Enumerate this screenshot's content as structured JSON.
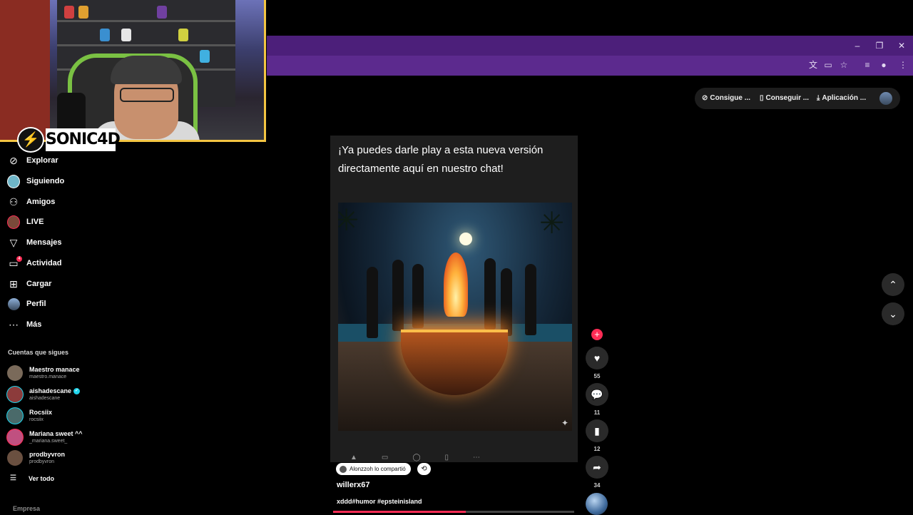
{
  "browser": {
    "window_controls": {
      "minimize": "–",
      "restore": "❐",
      "close": "✕"
    },
    "toolbar_icons": [
      "translate-icon",
      "cast-icon",
      "star-icon",
      "media-icon",
      "extension-icon",
      "menu-icon"
    ]
  },
  "overlay": {
    "brand_name": "SONIC4D",
    "brand_logo_glyph": "⚡"
  },
  "topbar": {
    "item1": "Consigue ...",
    "item2": "Conseguir ...",
    "item3": "Aplicación ..."
  },
  "sidebar": {
    "nav": [
      {
        "label": "Explorar",
        "icon": "compass-icon"
      },
      {
        "label": "Siguiendo",
        "icon": "following-avatar-icon"
      },
      {
        "label": "Amigos",
        "icon": "people-icon"
      },
      {
        "label": "LIVE",
        "icon": "live-avatar-icon"
      },
      {
        "label": "Mensajes",
        "icon": "send-icon"
      },
      {
        "label": "Actividad",
        "icon": "activity-icon",
        "badge": "4"
      },
      {
        "label": "Cargar",
        "icon": "plus-square-icon"
      },
      {
        "label": "Perfil",
        "icon": "profile-avatar-icon"
      },
      {
        "label": "Más",
        "icon": "more-icon"
      }
    ],
    "following_heading": "Cuentas que sigues",
    "following": [
      {
        "name": "Maestro manace",
        "handle": "maestro.manace",
        "color": "#7a6a5a"
      },
      {
        "name": "aishadescane",
        "handle": "aishadescane",
        "color": "#8c3b3b",
        "verified": true
      },
      {
        "name": "Rocsiix",
        "handle": "rocsiix",
        "color": "#4a6a6a"
      },
      {
        "name": "Mariana sweet ^^",
        "handle": "_mariana.sweet_",
        "color": "#c05080"
      },
      {
        "name": "prodbyvron",
        "handle": "prodbyvron",
        "color": "#6a5040"
      }
    ],
    "see_all": "Ver todo",
    "company": "Empresa"
  },
  "video": {
    "caption": "¡Ya puedes darle play a esta nueva versión directamente aquí en nuestro chat!",
    "reposted_by": "Alonzzoh lo compartió",
    "author": "willerx67",
    "description": "xddd#humor #epsteinisland",
    "progress": 0.55
  },
  "actions": {
    "likes": "55",
    "comments": "11",
    "saves": "12",
    "shares": "34"
  },
  "colors": {
    "accent": "#fe2c55",
    "chrome_purple": "#5c2a8e",
    "overlay_border": "#f4c542"
  }
}
